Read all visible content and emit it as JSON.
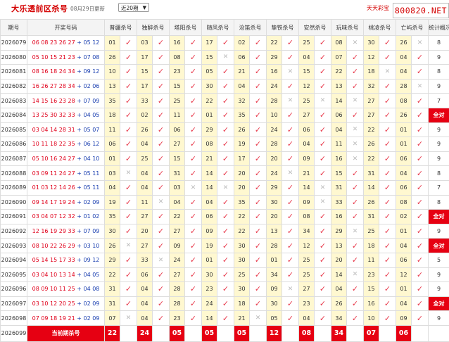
{
  "header": {
    "title": "大乐透前区杀号",
    "update": "08月29日更新",
    "select_value": "近20期",
    "brand": "天天彩宝",
    "watermark": "800820.NET"
  },
  "columns": [
    "期号",
    "开奖号码",
    "普疆杀号",
    "独醉杀号",
    "塔阳杀号",
    "随风杀号",
    "沧笛杀号",
    "挚铁杀号",
    "安然杀号",
    "玩味杀号",
    "桃凌杀号",
    "亡屿杀号",
    "统计概况"
  ],
  "rows": [
    {
      "period": "2026079",
      "red": "06 08 23 26 27",
      "blue": "05 12",
      "kills": [
        [
          "01",
          1
        ],
        [
          "03",
          1
        ],
        [
          "16",
          1
        ],
        [
          "17",
          1
        ],
        [
          "02",
          1
        ],
        [
          "22",
          1
        ],
        [
          "25",
          1
        ],
        [
          "08",
          0
        ],
        [
          "30",
          1
        ],
        [
          "26",
          0
        ]
      ],
      "stat": "8",
      "all": false
    },
    {
      "period": "2026080",
      "red": "05 10 15 21 23",
      "blue": "07 08",
      "kills": [
        [
          "26",
          1
        ],
        [
          "17",
          1
        ],
        [
          "08",
          1
        ],
        [
          "15",
          0
        ],
        [
          "06",
          1
        ],
        [
          "29",
          1
        ],
        [
          "04",
          1
        ],
        [
          "07",
          1
        ],
        [
          "12",
          1
        ],
        [
          "04",
          1
        ]
      ],
      "stat": "9",
      "all": false
    },
    {
      "period": "2026081",
      "red": "08 16 18 24 34",
      "blue": "09 12",
      "kills": [
        [
          "10",
          1
        ],
        [
          "15",
          1
        ],
        [
          "23",
          1
        ],
        [
          "05",
          1
        ],
        [
          "21",
          1
        ],
        [
          "16",
          0
        ],
        [
          "15",
          1
        ],
        [
          "22",
          1
        ],
        [
          "18",
          0
        ],
        [
          "04",
          1
        ]
      ],
      "stat": "8",
      "all": false
    },
    {
      "period": "2026082",
      "red": "16 26 27 28 34",
      "blue": "02 06",
      "kills": [
        [
          "13",
          1
        ],
        [
          "17",
          1
        ],
        [
          "15",
          1
        ],
        [
          "30",
          1
        ],
        [
          "04",
          1
        ],
        [
          "24",
          1
        ],
        [
          "12",
          1
        ],
        [
          "13",
          1
        ],
        [
          "32",
          1
        ],
        [
          "28",
          0
        ]
      ],
      "stat": "9",
      "all": false
    },
    {
      "period": "2026083",
      "red": "14 15 16 23 28",
      "blue": "07 09",
      "kills": [
        [
          "35",
          1
        ],
        [
          "33",
          1
        ],
        [
          "25",
          1
        ],
        [
          "22",
          1
        ],
        [
          "32",
          1
        ],
        [
          "28",
          0
        ],
        [
          "25",
          0
        ],
        [
          "14",
          0
        ],
        [
          "27",
          1
        ],
        [
          "08",
          1
        ]
      ],
      "stat": "7",
      "all": false
    },
    {
      "period": "2026084",
      "red": "13 25 30 32 33",
      "blue": "04 05",
      "kills": [
        [
          "18",
          1
        ],
        [
          "02",
          1
        ],
        [
          "11",
          1
        ],
        [
          "01",
          1
        ],
        [
          "35",
          1
        ],
        [
          "10",
          1
        ],
        [
          "27",
          1
        ],
        [
          "06",
          1
        ],
        [
          "27",
          1
        ],
        [
          "26",
          1
        ]
      ],
      "stat": "全对",
      "all": true
    },
    {
      "period": "2026085",
      "red": "03 04 14 28 31",
      "blue": "05 07",
      "kills": [
        [
          "11",
          1
        ],
        [
          "26",
          1
        ],
        [
          "06",
          1
        ],
        [
          "29",
          1
        ],
        [
          "26",
          1
        ],
        [
          "24",
          1
        ],
        [
          "06",
          1
        ],
        [
          "04",
          0
        ],
        [
          "22",
          1
        ],
        [
          "01",
          1
        ]
      ],
      "stat": "9",
      "all": false
    },
    {
      "period": "2026086",
      "red": "10 11 18 22 35",
      "blue": "06 12",
      "kills": [
        [
          "06",
          1
        ],
        [
          "04",
          1
        ],
        [
          "27",
          1
        ],
        [
          "08",
          1
        ],
        [
          "19",
          1
        ],
        [
          "28",
          1
        ],
        [
          "04",
          1
        ],
        [
          "11",
          0
        ],
        [
          "26",
          1
        ],
        [
          "01",
          1
        ]
      ],
      "stat": "9",
      "all": false
    },
    {
      "period": "2026087",
      "red": "05 10 16 24 27",
      "blue": "04 10",
      "kills": [
        [
          "01",
          1
        ],
        [
          "25",
          1
        ],
        [
          "15",
          1
        ],
        [
          "21",
          1
        ],
        [
          "17",
          1
        ],
        [
          "20",
          1
        ],
        [
          "09",
          1
        ],
        [
          "16",
          0
        ],
        [
          "22",
          1
        ],
        [
          "06",
          1
        ]
      ],
      "stat": "9",
      "all": false
    },
    {
      "period": "2026088",
      "red": "03 09 11 24 27",
      "blue": "05 11",
      "kills": [
        [
          "03",
          0
        ],
        [
          "04",
          1
        ],
        [
          "31",
          1
        ],
        [
          "14",
          1
        ],
        [
          "20",
          1
        ],
        [
          "24",
          0
        ],
        [
          "21",
          1
        ],
        [
          "15",
          1
        ],
        [
          "31",
          1
        ],
        [
          "04",
          1
        ]
      ],
      "stat": "8",
      "all": false
    },
    {
      "period": "2026089",
      "red": "01 03 12 14 26",
      "blue": "05 11",
      "kills": [
        [
          "04",
          1
        ],
        [
          "04",
          1
        ],
        [
          "03",
          0
        ],
        [
          "14",
          0
        ],
        [
          "20",
          1
        ],
        [
          "29",
          1
        ],
        [
          "14",
          0
        ],
        [
          "31",
          1
        ],
        [
          "14",
          1
        ],
        [
          "06",
          1
        ]
      ],
      "stat": "7",
      "all": false
    },
    {
      "period": "2026090",
      "red": "09 14 17 19 24",
      "blue": "02 09",
      "kills": [
        [
          "19",
          1
        ],
        [
          "11",
          0
        ],
        [
          "04",
          1
        ],
        [
          "04",
          1
        ],
        [
          "35",
          1
        ],
        [
          "30",
          1
        ],
        [
          "09",
          0
        ],
        [
          "33",
          1
        ],
        [
          "26",
          1
        ],
        [
          "08",
          1
        ]
      ],
      "stat": "8",
      "all": false
    },
    {
      "period": "2026091",
      "red": "03 04 07 12 32",
      "blue": "01 02",
      "kills": [
        [
          "35",
          1
        ],
        [
          "27",
          1
        ],
        [
          "22",
          1
        ],
        [
          "06",
          1
        ],
        [
          "22",
          1
        ],
        [
          "20",
          1
        ],
        [
          "08",
          1
        ],
        [
          "16",
          1
        ],
        [
          "31",
          1
        ],
        [
          "02",
          1
        ]
      ],
      "stat": "全对",
      "all": true
    },
    {
      "period": "2026092",
      "red": "12 16 19 29 33",
      "blue": "07 09",
      "kills": [
        [
          "30",
          1
        ],
        [
          "20",
          1
        ],
        [
          "27",
          1
        ],
        [
          "09",
          1
        ],
        [
          "22",
          1
        ],
        [
          "13",
          1
        ],
        [
          "34",
          1
        ],
        [
          "29",
          0
        ],
        [
          "25",
          1
        ],
        [
          "01",
          1
        ]
      ],
      "stat": "9",
      "all": false
    },
    {
      "period": "2026093",
      "red": "08 10 22 26 29",
      "blue": "03 10",
      "kills": [
        [
          "26",
          0
        ],
        [
          "27",
          1
        ],
        [
          "09",
          1
        ],
        [
          "19",
          1
        ],
        [
          "30",
          1
        ],
        [
          "28",
          1
        ],
        [
          "12",
          1
        ],
        [
          "13",
          1
        ],
        [
          "18",
          1
        ],
        [
          "04",
          1
        ]
      ],
      "stat": "全对",
      "all": true
    },
    {
      "period": "2026094",
      "red": "05 14 15 17 33",
      "blue": "09 12",
      "kills": [
        [
          "29",
          1
        ],
        [
          "33",
          0
        ],
        [
          "24",
          1
        ],
        [
          "01",
          1
        ],
        [
          "30",
          1
        ],
        [
          "01",
          1
        ],
        [
          "25",
          1
        ],
        [
          "20",
          1
        ],
        [
          "11",
          1
        ],
        [
          "06",
          1
        ]
      ],
      "stat": "5",
      "all": false
    },
    {
      "period": "2026095",
      "red": "03 04 10 13 14",
      "blue": "04 05",
      "kills": [
        [
          "22",
          1
        ],
        [
          "06",
          1
        ],
        [
          "27",
          1
        ],
        [
          "30",
          1
        ],
        [
          "25",
          1
        ],
        [
          "34",
          1
        ],
        [
          "25",
          1
        ],
        [
          "14",
          0
        ],
        [
          "23",
          1
        ],
        [
          "12",
          1
        ]
      ],
      "stat": "9",
      "all": false
    },
    {
      "period": "2026096",
      "red": "08 09 10 11 25",
      "blue": "04 08",
      "kills": [
        [
          "31",
          1
        ],
        [
          "04",
          1
        ],
        [
          "28",
          1
        ],
        [
          "23",
          1
        ],
        [
          "30",
          1
        ],
        [
          "09",
          0
        ],
        [
          "27",
          1
        ],
        [
          "04",
          1
        ],
        [
          "15",
          1
        ],
        [
          "01",
          1
        ]
      ],
      "stat": "9",
      "all": false
    },
    {
      "period": "2026097",
      "red": "03 10 12 20 25",
      "blue": "02 09",
      "kills": [
        [
          "31",
          1
        ],
        [
          "04",
          1
        ],
        [
          "28",
          1
        ],
        [
          "24",
          1
        ],
        [
          "18",
          1
        ],
        [
          "30",
          1
        ],
        [
          "23",
          1
        ],
        [
          "26",
          1
        ],
        [
          "16",
          1
        ],
        [
          "04",
          1
        ]
      ],
      "stat": "全对",
      "all": true
    },
    {
      "period": "2026098",
      "red": "07 09 18 19 21",
      "blue": "02 09",
      "kills": [
        [
          "07",
          0
        ],
        [
          "04",
          1
        ],
        [
          "23",
          1
        ],
        [
          "14",
          1
        ],
        [
          "21",
          0
        ],
        [
          "05",
          1
        ],
        [
          "04",
          1
        ],
        [
          "34",
          1
        ],
        [
          "10",
          1
        ],
        [
          "09",
          1
        ]
      ],
      "stat": "9",
      "all": false
    }
  ],
  "current": {
    "period": "2026099",
    "label": "当前期杀号",
    "kills": [
      "22",
      "24",
      "05",
      "05",
      "05",
      "12",
      "08",
      "34",
      "07",
      "06"
    ]
  }
}
